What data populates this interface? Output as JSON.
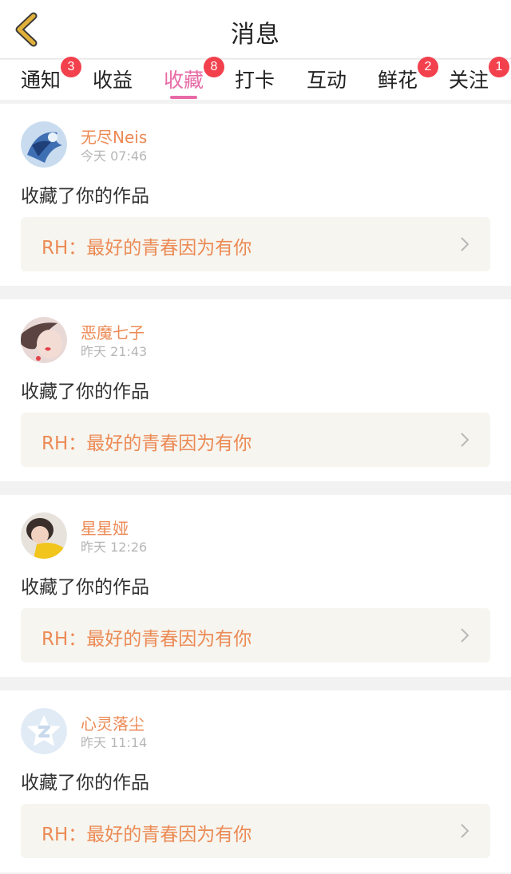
{
  "header": {
    "title": "消息"
  },
  "tabs": [
    {
      "label": "通知",
      "badge": "3"
    },
    {
      "label": "收益",
      "badge": ""
    },
    {
      "label": "收藏",
      "badge": "8",
      "active": true
    },
    {
      "label": "打卡",
      "badge": ""
    },
    {
      "label": "互动",
      "badge": ""
    },
    {
      "label": "鲜花",
      "badge": "2"
    },
    {
      "label": "关注",
      "badge": "1"
    }
  ],
  "messages": [
    {
      "user": "无尽Neis",
      "time": "今天 07:46",
      "action": "收藏了你的作品",
      "work": "RH：最好的青春因为有你"
    },
    {
      "user": "恶魔七子",
      "time": "昨天 21:43",
      "action": "收藏了你的作品",
      "work": "RH：最好的青春因为有你"
    },
    {
      "user": "星星娅",
      "time": "昨天 12:26",
      "action": "收藏了你的作品",
      "work": "RH：最好的青春因为有你"
    },
    {
      "user": "心灵落尘",
      "time": "昨天 11:14",
      "action": "收藏了你的作品",
      "work": "RH：最好的青春因为有你"
    }
  ],
  "colors": {
    "accent": "#e86aa6",
    "username": "#ec8a55",
    "badge": "#f2414d",
    "back_arrow": "#e0b03a"
  }
}
